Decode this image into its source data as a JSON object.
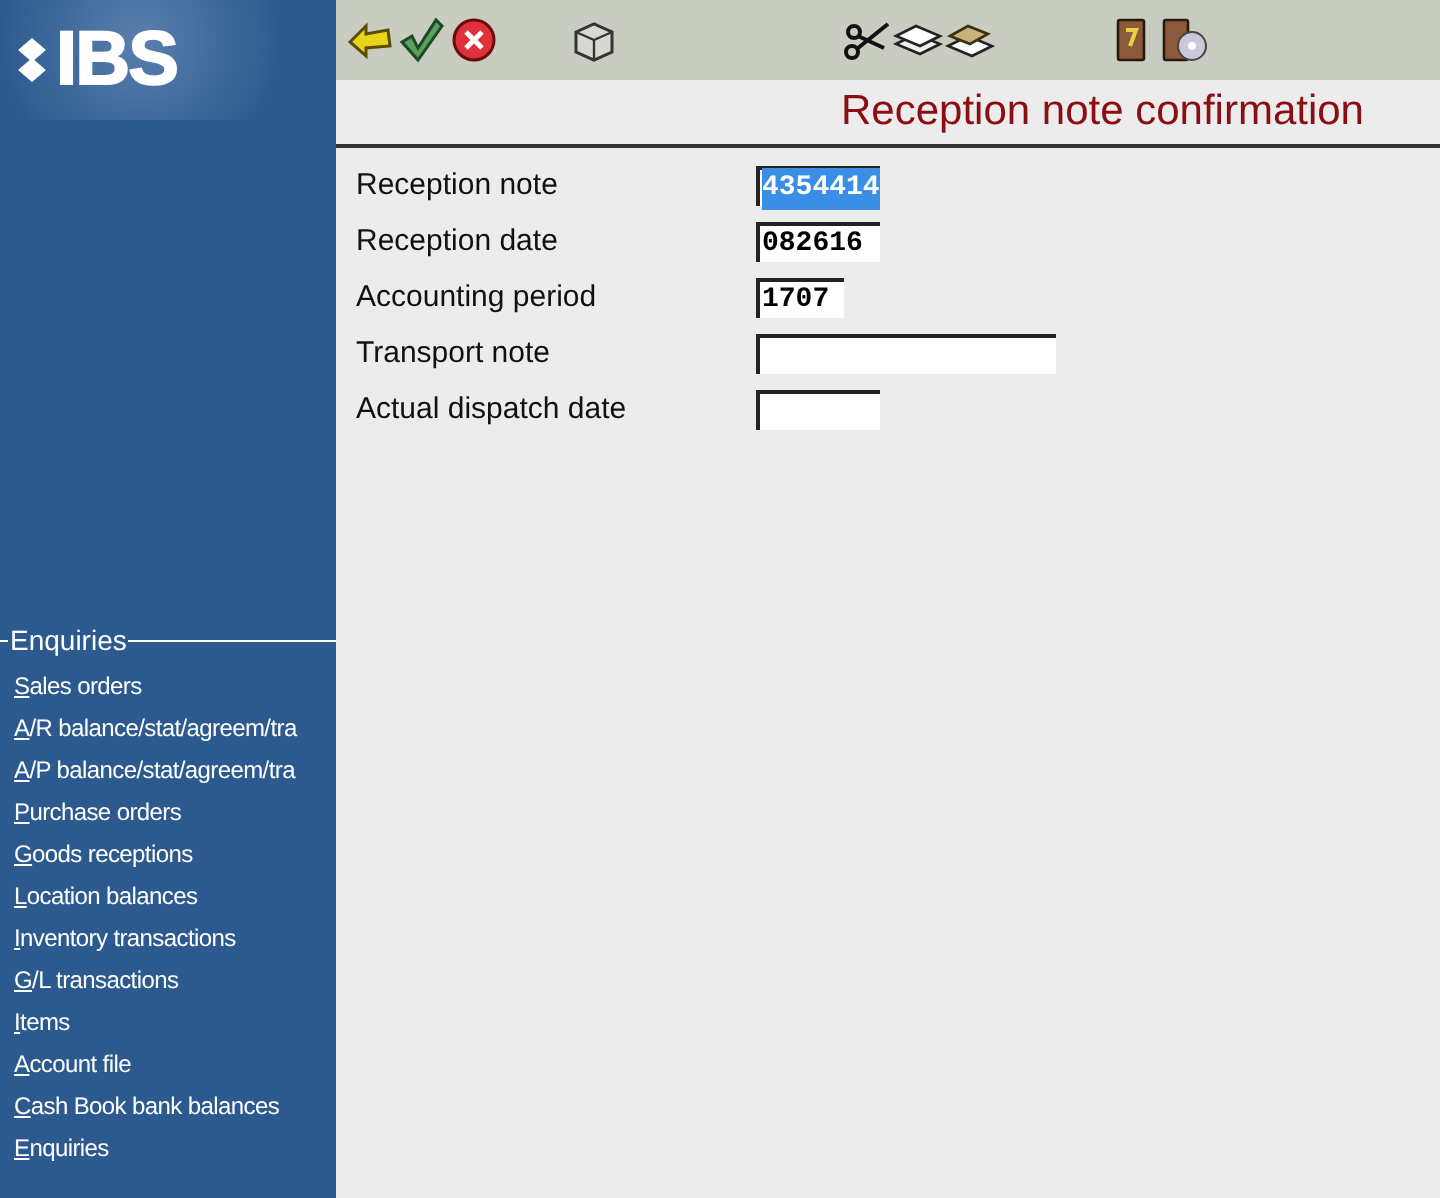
{
  "logo": {
    "text": "IBS"
  },
  "title": "Reception note confirmation",
  "form": [
    {
      "label": "Reception note",
      "value": "4354414",
      "highlighted": true
    },
    {
      "label": "Reception date",
      "value": "082616",
      "highlighted": false
    },
    {
      "label": "Accounting period",
      "value": "1707",
      "highlighted": false
    },
    {
      "label": "Transport note"
    },
    {
      "label": "Actual dispatch date"
    }
  ],
  "sidebar": {
    "heading": "Enquiries",
    "items": [
      "Sales orders",
      "A/R balance/stat/agreem/tra",
      "A/P balance/stat/agreem/tra",
      "Purchase orders",
      "Goods receptions",
      "Location balances",
      "Inventory transactions",
      "G/L transactions",
      "Items",
      "Account file",
      "Cash Book bank balances",
      "Enquiries"
    ]
  }
}
